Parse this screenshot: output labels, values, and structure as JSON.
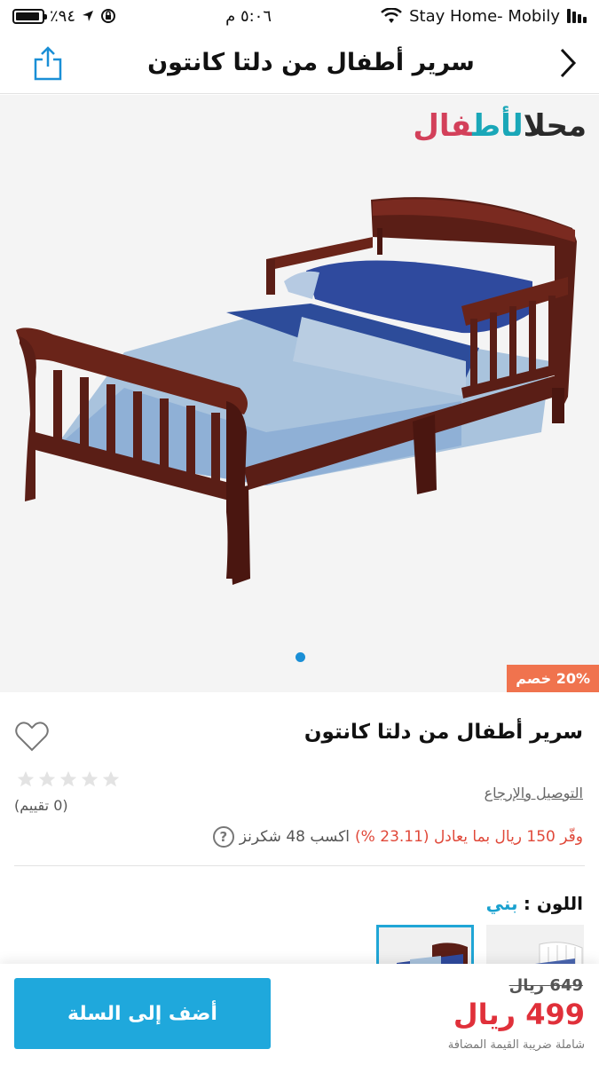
{
  "status_bar": {
    "battery": "٪٩٤",
    "time": "٥:٠٦ م",
    "carrier": "Stay Home- Mobily"
  },
  "nav": {
    "title": "سرير أطفال من دلتا كانتون",
    "back_icon": "chevron-right-icon",
    "share_icon": "share-icon"
  },
  "gallery": {
    "brand_part1": "محل",
    "brand_part2": "الأط",
    "brand_part3": "فال",
    "discount": "20% خصم",
    "image_alt": "wooden toddler bed with blue bedding",
    "page_dots": 1
  },
  "product": {
    "title": "سرير أطفال من دلتا كانتون",
    "rating_count": "(0 تقييم)",
    "rating": 0,
    "delivery_link": "التوصيل والإرجاع",
    "savings_text": "وفّر 150 ريال بما يعادل (23.11 %)",
    "points_text": "اكسب 48 شكرنز",
    "help_glyph": "?",
    "color_label": "اللون :",
    "color_value": "بني"
  },
  "bottom": {
    "cart_button": "أضف إلى السلة",
    "old_price": "649 ريال",
    "new_price": "499 ريال",
    "vat_note": "شاملة ضريبة القيمة المضافة"
  },
  "colors": {
    "accent": "#1fa8dc",
    "price_red": "#e0303a",
    "discount_orange": "#f0734e"
  }
}
